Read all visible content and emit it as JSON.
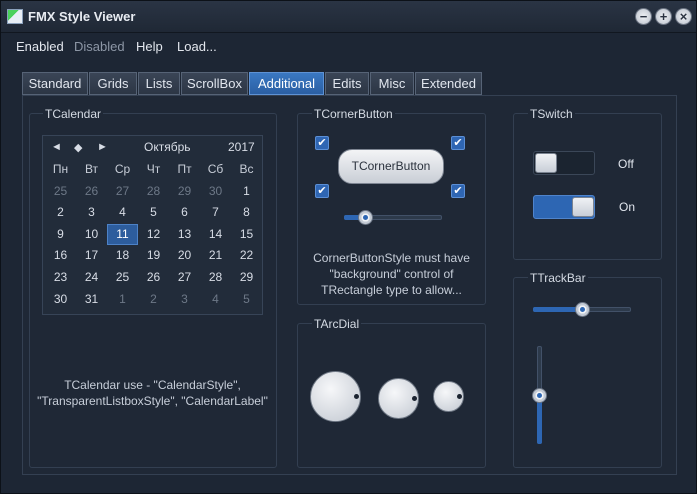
{
  "window": {
    "title": "FMX Style Viewer"
  },
  "menu": [
    "Enabled",
    "Disabled",
    "Help",
    "Load..."
  ],
  "tabs": [
    "Standard",
    "Grids",
    "Lists",
    "ScrollBox",
    "Additional",
    "Edits",
    "Misc",
    "Extended"
  ],
  "active_tab": "Additional",
  "calendar": {
    "group_label": "TCalendar",
    "nav_prev": "◄",
    "nav_today": "◆",
    "nav_next": "►",
    "month": "Октябрь",
    "year": "2017",
    "weekdays": [
      "Пн",
      "Вт",
      "Ср",
      "Чт",
      "Пт",
      "Сб",
      "Вс"
    ],
    "days": [
      [
        "25",
        "26",
        "27",
        "28",
        "29",
        "30",
        "1"
      ],
      [
        "2",
        "3",
        "4",
        "5",
        "6",
        "7",
        "8"
      ],
      [
        "9",
        "10",
        "11",
        "12",
        "13",
        "14",
        "15"
      ],
      [
        "16",
        "17",
        "18",
        "19",
        "20",
        "21",
        "22"
      ],
      [
        "23",
        "24",
        "25",
        "26",
        "27",
        "28",
        "29"
      ],
      [
        "30",
        "31",
        "1",
        "2",
        "3",
        "4",
        "5"
      ]
    ],
    "selected_day": "11",
    "caption_line1": "TCalendar use - \"CalendarStyle\",",
    "caption_line2": "\"TransparentListboxStyle\", \"CalendarLabel\""
  },
  "corner": {
    "group_label": "TCornerButton",
    "button_label": "TCornerButton",
    "check_mark": "✔",
    "slider_value": 0.21,
    "caption_line1": "CornerButtonStyle must have",
    "caption_line2": "\"background\" control of",
    "caption_line3": "TRectangle type to allow..."
  },
  "arcdial": {
    "group_label": "TArcDial"
  },
  "switch": {
    "group_label": "TSwitch",
    "off_label": "Off",
    "on_label": "On"
  },
  "trackbar": {
    "group_label": "TTrackBar",
    "horizontal_value": 0.5,
    "vertical_value": 0.5
  },
  "colors": {
    "accent": "#2d66b3",
    "background": "#1d2634"
  }
}
